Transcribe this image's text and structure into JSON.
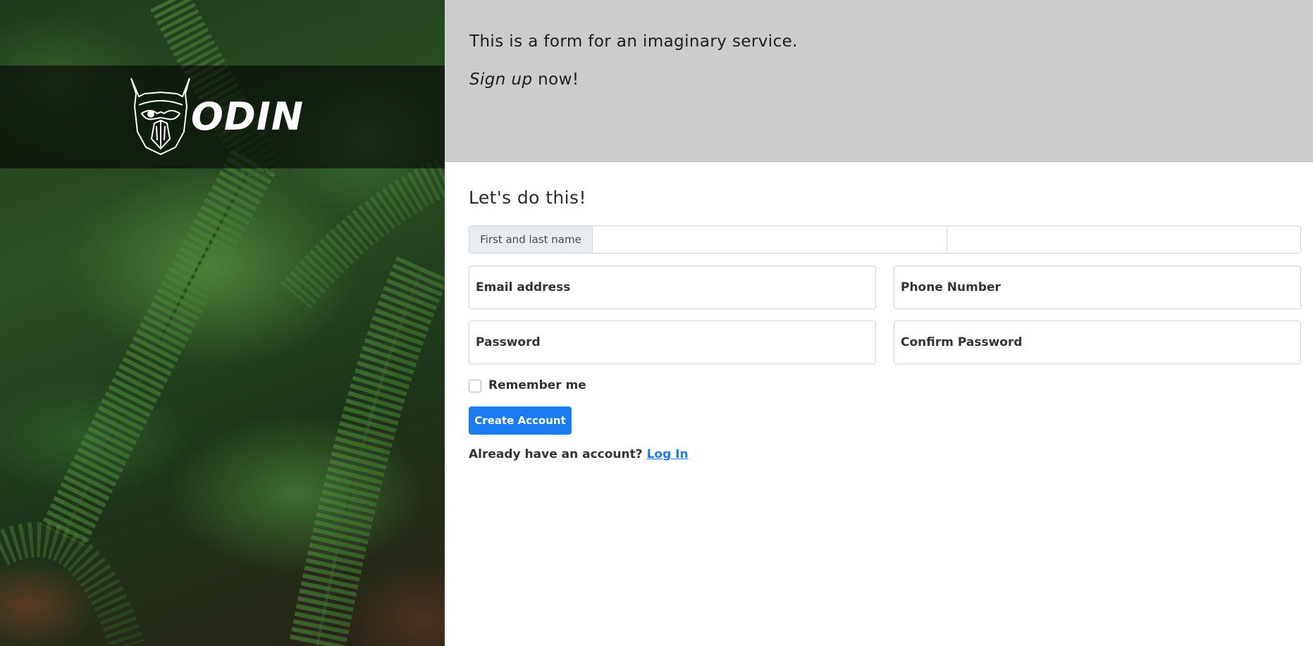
{
  "brand": {
    "name": "ODIN",
    "logo_icon": "viking-helmet-icon"
  },
  "intro": {
    "line1": "This is a form for an imaginary service.",
    "signup_emphasis": "Sign up",
    "signup_rest": " now!"
  },
  "form": {
    "title": "Let's do this!",
    "name_label": "First and last name",
    "first_name_value": "",
    "last_name_value": "",
    "email_label": "Email address",
    "phone_label": "Phone Number",
    "password_label": "Password",
    "confirm_password_label": "Confirm Password",
    "remember_label": "Remember me",
    "remember_checked": false,
    "submit_label": "Create Account",
    "login_prompt": "Already have an account? ",
    "login_link": "Log In"
  },
  "colors": {
    "accent": "#1a7bf2",
    "intro_background": "#cccccc",
    "logo_band": "rgba(0,0,0,0.58)"
  }
}
